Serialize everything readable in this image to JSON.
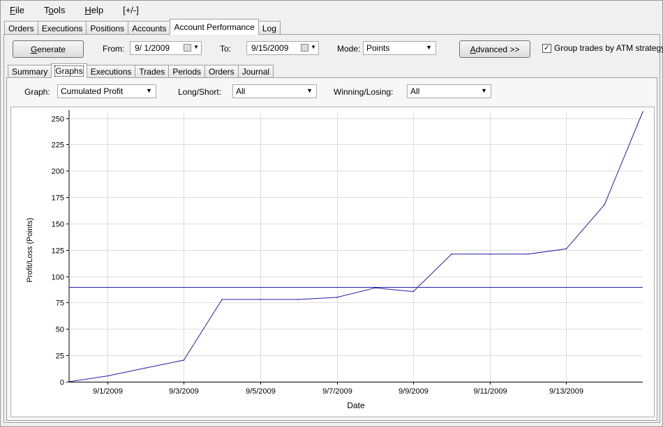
{
  "menu": {
    "file": {
      "key": "F",
      "rest": "ile"
    },
    "tools": {
      "pre": "T",
      "key": "o",
      "rest": "ols"
    },
    "help": {
      "key": "H",
      "rest": "elp"
    },
    "plusminus": "[+/-]"
  },
  "main_tabs": [
    "Orders",
    "Executions",
    "Positions",
    "Accounts",
    "Account Performance",
    "Log"
  ],
  "toolbar": {
    "generate_label": "Generate",
    "generate_key": "G",
    "generate_rest": "enerate",
    "from_label": "From:",
    "from_value": "9/ 1/2009",
    "to_label": "To:",
    "to_value": "9/15/2009",
    "mode_label": "Mode:",
    "mode_value": "Points",
    "advanced_key": "A",
    "advanced_rest": "dvanced >>",
    "group_trades_label": "Group trades by ATM strategy",
    "group_trades_checked": "✓"
  },
  "sub_tabs": [
    "Summary",
    "Graphs",
    "Executions",
    "Trades",
    "Periods",
    "Orders",
    "Journal"
  ],
  "filters": {
    "graph_label": "Graph:",
    "graph_value": "Cumulated Profit",
    "longshort_label": "Long/Short:",
    "longshort_value": "All",
    "winlose_label": "Winning/Losing:",
    "winlose_value": "All"
  },
  "colors": {
    "line": "#1f1fa8",
    "grid": "#dcdcdc",
    "axis": "#000000"
  },
  "chart_data": {
    "type": "line",
    "xlabel": "Date",
    "ylabel": "Profit/Loss (Points)",
    "ylim": [
      0,
      255
    ],
    "yticks": [
      0,
      25,
      50,
      75,
      100,
      125,
      150,
      175,
      200,
      225,
      250
    ],
    "xlim": [
      "2009-08-31",
      "2009-09-15"
    ],
    "xticks": [
      "9/1/2009",
      "9/3/2009",
      "9/5/2009",
      "9/7/2009",
      "9/9/2009",
      "9/11/2009",
      "9/13/2009"
    ],
    "xtick_dates": [
      "2009-09-01",
      "2009-09-03",
      "2009-09-05",
      "2009-09-07",
      "2009-09-09",
      "2009-09-11",
      "2009-09-13"
    ],
    "series": [
      {
        "x": [
          "2009-08-31",
          "2009-09-01",
          "2009-09-02",
          "2009-09-03",
          "2009-09-04",
          "2009-09-05",
          "2009-09-06",
          "2009-09-07",
          "2009-09-08",
          "2009-09-09",
          "2009-09-10",
          "2009-09-11",
          "2009-09-12",
          "2009-09-13",
          "2009-09-14",
          "2009-09-15"
        ],
        "values": [
          0,
          5.5,
          13,
          20.5,
          78,
          78,
          78,
          80,
          89,
          85.5,
          121,
          121,
          121,
          126,
          168,
          256
        ]
      }
    ],
    "reference_line": 90,
    "grid": true
  }
}
